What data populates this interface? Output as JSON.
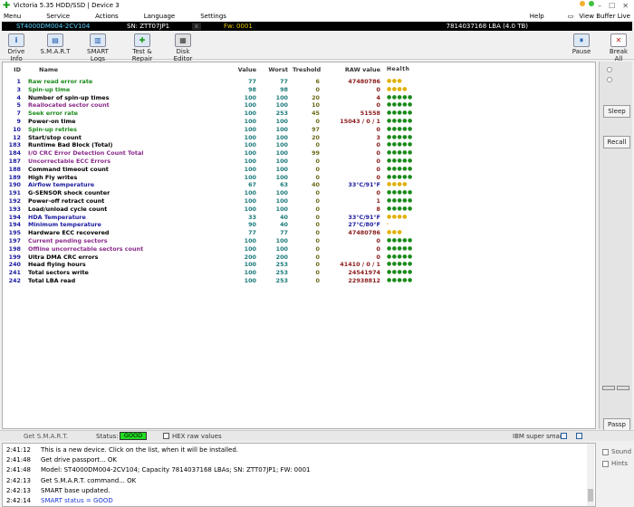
{
  "window": {
    "title": "Victoria 5.35 HDD/SSD | Device 3"
  },
  "menu": {
    "items": [
      "Menu",
      "Service",
      "Actions",
      "Language",
      "Settings"
    ],
    "help": "Help",
    "view_buffer": "View Buffer Live"
  },
  "device": {
    "model": "ST4000DM004-2CV104",
    "sn": "SN: ZTT07JP1",
    "fw": "Fw: 0001",
    "lba": "7814037168 LBA (4.0 TB)"
  },
  "toolbar": {
    "drive_info": "Drive Info",
    "smart": "S.M.A.R.T",
    "smart_logs": "SMART Logs",
    "test_repair": "Test & Repair",
    "disk_editor": "Disk Editor",
    "pause": "Pause",
    "break_all": "Break All"
  },
  "table": {
    "headers": {
      "id": "ID",
      "name": "Name",
      "value": "Value",
      "worst": "Worst",
      "treshold": "Treshold",
      "raw": "RAW value",
      "health": "Health"
    },
    "rows": [
      {
        "id": "1",
        "name": "Raw read error rate",
        "value": "77",
        "worst": "77",
        "tresh": "6",
        "raw": "47480786",
        "health": "●●●",
        "nc": "#1a8a1a",
        "hc": "#e0b000"
      },
      {
        "id": "3",
        "name": "Spin-up time",
        "value": "98",
        "worst": "98",
        "tresh": "0",
        "raw": "0",
        "health": "●●●●",
        "nc": "#1a8a1a",
        "hc": "#e0b000"
      },
      {
        "id": "4",
        "name": "Number of spin-up times",
        "value": "100",
        "worst": "100",
        "tresh": "20",
        "raw": "4",
        "health": "●●●●●",
        "nc": "#000",
        "hc": "#1a8a1a"
      },
      {
        "id": "5",
        "name": "Reallocated sector count",
        "value": "100",
        "worst": "100",
        "tresh": "10",
        "raw": "0",
        "health": "●●●●●",
        "nc": "#8a2a8a",
        "hc": "#1a8a1a"
      },
      {
        "id": "7",
        "name": "Seek error rate",
        "value": "100",
        "worst": "253",
        "tresh": "45",
        "raw": "51558",
        "health": "●●●●●",
        "nc": "#1a8a1a",
        "hc": "#1a8a1a"
      },
      {
        "id": "9",
        "name": "Power-on time",
        "value": "100",
        "worst": "100",
        "tresh": "0",
        "raw": "15043 / 0 / 1",
        "health": "●●●●●",
        "nc": "#000",
        "hc": "#1a8a1a"
      },
      {
        "id": "10",
        "name": "Spin-up retries",
        "value": "100",
        "worst": "100",
        "tresh": "97",
        "raw": "0",
        "health": "●●●●●",
        "nc": "#1a8a1a",
        "hc": "#1a8a1a"
      },
      {
        "id": "12",
        "name": "Start/stop count",
        "value": "100",
        "worst": "100",
        "tresh": "20",
        "raw": "3",
        "health": "●●●●●",
        "nc": "#000",
        "hc": "#1a8a1a"
      },
      {
        "id": "183",
        "name": "Runtime Bad Block (Total)",
        "value": "100",
        "worst": "100",
        "tresh": "0",
        "raw": "0",
        "health": "●●●●●",
        "nc": "#000",
        "hc": "#1a8a1a"
      },
      {
        "id": "184",
        "name": "I/O CRC Error Detection Count Total",
        "value": "100",
        "worst": "100",
        "tresh": "99",
        "raw": "0",
        "health": "●●●●●",
        "nc": "#8a2a8a",
        "hc": "#1a8a1a"
      },
      {
        "id": "187",
        "name": "Uncorrectable ECC Errors",
        "value": "100",
        "worst": "100",
        "tresh": "0",
        "raw": "0",
        "health": "●●●●●",
        "nc": "#8a2a8a",
        "hc": "#1a8a1a"
      },
      {
        "id": "188",
        "name": "Command timeout count",
        "value": "100",
        "worst": "100",
        "tresh": "0",
        "raw": "0",
        "health": "●●●●●",
        "nc": "#000",
        "hc": "#1a8a1a"
      },
      {
        "id": "189",
        "name": "High Fly writes",
        "value": "100",
        "worst": "100",
        "tresh": "0",
        "raw": "0",
        "health": "●●●●●",
        "nc": "#000",
        "hc": "#1a8a1a"
      },
      {
        "id": "190",
        "name": "Airflow temperature",
        "value": "67",
        "worst": "63",
        "tresh": "40",
        "raw": "33°C/91°F",
        "health": "●●●●",
        "nc": "#1a1aa0",
        "hc": "#e0b000"
      },
      {
        "id": "191",
        "name": "G-SENSOR shock counter",
        "value": "100",
        "worst": "100",
        "tresh": "0",
        "raw": "0",
        "health": "●●●●●",
        "nc": "#000",
        "hc": "#1a8a1a"
      },
      {
        "id": "192",
        "name": "Power-off retract count",
        "value": "100",
        "worst": "100",
        "tresh": "0",
        "raw": "1",
        "health": "●●●●●",
        "nc": "#000",
        "hc": "#1a8a1a"
      },
      {
        "id": "193",
        "name": "Load/unload cycle count",
        "value": "100",
        "worst": "100",
        "tresh": "0",
        "raw": "8",
        "health": "●●●●●",
        "nc": "#000",
        "hc": "#1a8a1a"
      },
      {
        "id": "194",
        "name": "HDA Temperature",
        "value": "33",
        "worst": "40",
        "tresh": "0",
        "raw": "33°C/91°F",
        "health": "●●●●",
        "nc": "#1a1aa0",
        "hc": "#e0b000"
      },
      {
        "id": "194",
        "name": "Minimum temperature",
        "value": "90",
        "worst": "40",
        "tresh": "0",
        "raw": "27°C/80°F",
        "health": "-",
        "nc": "#1a1aa0",
        "hc": "#e0b000"
      },
      {
        "id": "195",
        "name": "Hardware ECC recovered",
        "value": "77",
        "worst": "77",
        "tresh": "0",
        "raw": "47480786",
        "health": "●●●",
        "nc": "#000",
        "hc": "#e0b000"
      },
      {
        "id": "197",
        "name": "Current pending sectors",
        "value": "100",
        "worst": "100",
        "tresh": "0",
        "raw": "0",
        "health": "●●●●●",
        "nc": "#8a2a8a",
        "hc": "#1a8a1a"
      },
      {
        "id": "198",
        "name": "Offline uncorrectable sectors count",
        "value": "100",
        "worst": "100",
        "tresh": "0",
        "raw": "0",
        "health": "●●●●●",
        "nc": "#8a2a8a",
        "hc": "#1a8a1a"
      },
      {
        "id": "199",
        "name": "Ultra DMA CRC errors",
        "value": "200",
        "worst": "200",
        "tresh": "0",
        "raw": "0",
        "health": "●●●●●",
        "nc": "#000",
        "hc": "#1a8a1a"
      },
      {
        "id": "240",
        "name": "Head flying hours",
        "value": "100",
        "worst": "253",
        "tresh": "0",
        "raw": "41410 / 0 / 1",
        "health": "●●●●●",
        "nc": "#000",
        "hc": "#1a8a1a"
      },
      {
        "id": "241",
        "name": "Total sectors write",
        "value": "100",
        "worst": "253",
        "tresh": "0",
        "raw": "24541974",
        "health": "●●●●●",
        "nc": "#000",
        "hc": "#1a8a1a"
      },
      {
        "id": "242",
        "name": "Total LBA read",
        "value": "100",
        "worst": "253",
        "tresh": "0",
        "raw": "22938812",
        "health": "●●●●●",
        "nc": "#000",
        "hc": "#1a8a1a"
      }
    ]
  },
  "rightpanel": {
    "sleep": "Sleep",
    "recall": "Recall",
    "passp": "Passp"
  },
  "status": {
    "get_smart": "Get S.M.A.R.T.",
    "status_label": "Status:",
    "status_value": "GOOD",
    "hex_label": "HEX raw values",
    "ibm_label": "IBM super smart:"
  },
  "log": {
    "lines": [
      {
        "time": "2:41:12",
        "msg": "This is a new device. Click on the list, when it will be installed.",
        "color": "#000"
      },
      {
        "time": "2:41:48",
        "msg": "Get drive passport... OK",
        "color": "#000"
      },
      {
        "time": "2:41:48",
        "msg": "Model: ST4000DM004-2CV104; Capacity 7814037168 LBAs; SN: ZTT07JP1; FW: 0001",
        "color": "#000"
      },
      {
        "time": "2:42:13",
        "msg": "Get S.M.A.R.T. command... OK",
        "color": "#000"
      },
      {
        "time": "2:42:13",
        "msg": "SMART base updated.",
        "color": "#000"
      },
      {
        "time": "2:42:14",
        "msg": "SMART status = GOOD",
        "color": "#1a3ad0"
      }
    ]
  },
  "options": {
    "sound": "Sound",
    "hints": "Hints"
  }
}
